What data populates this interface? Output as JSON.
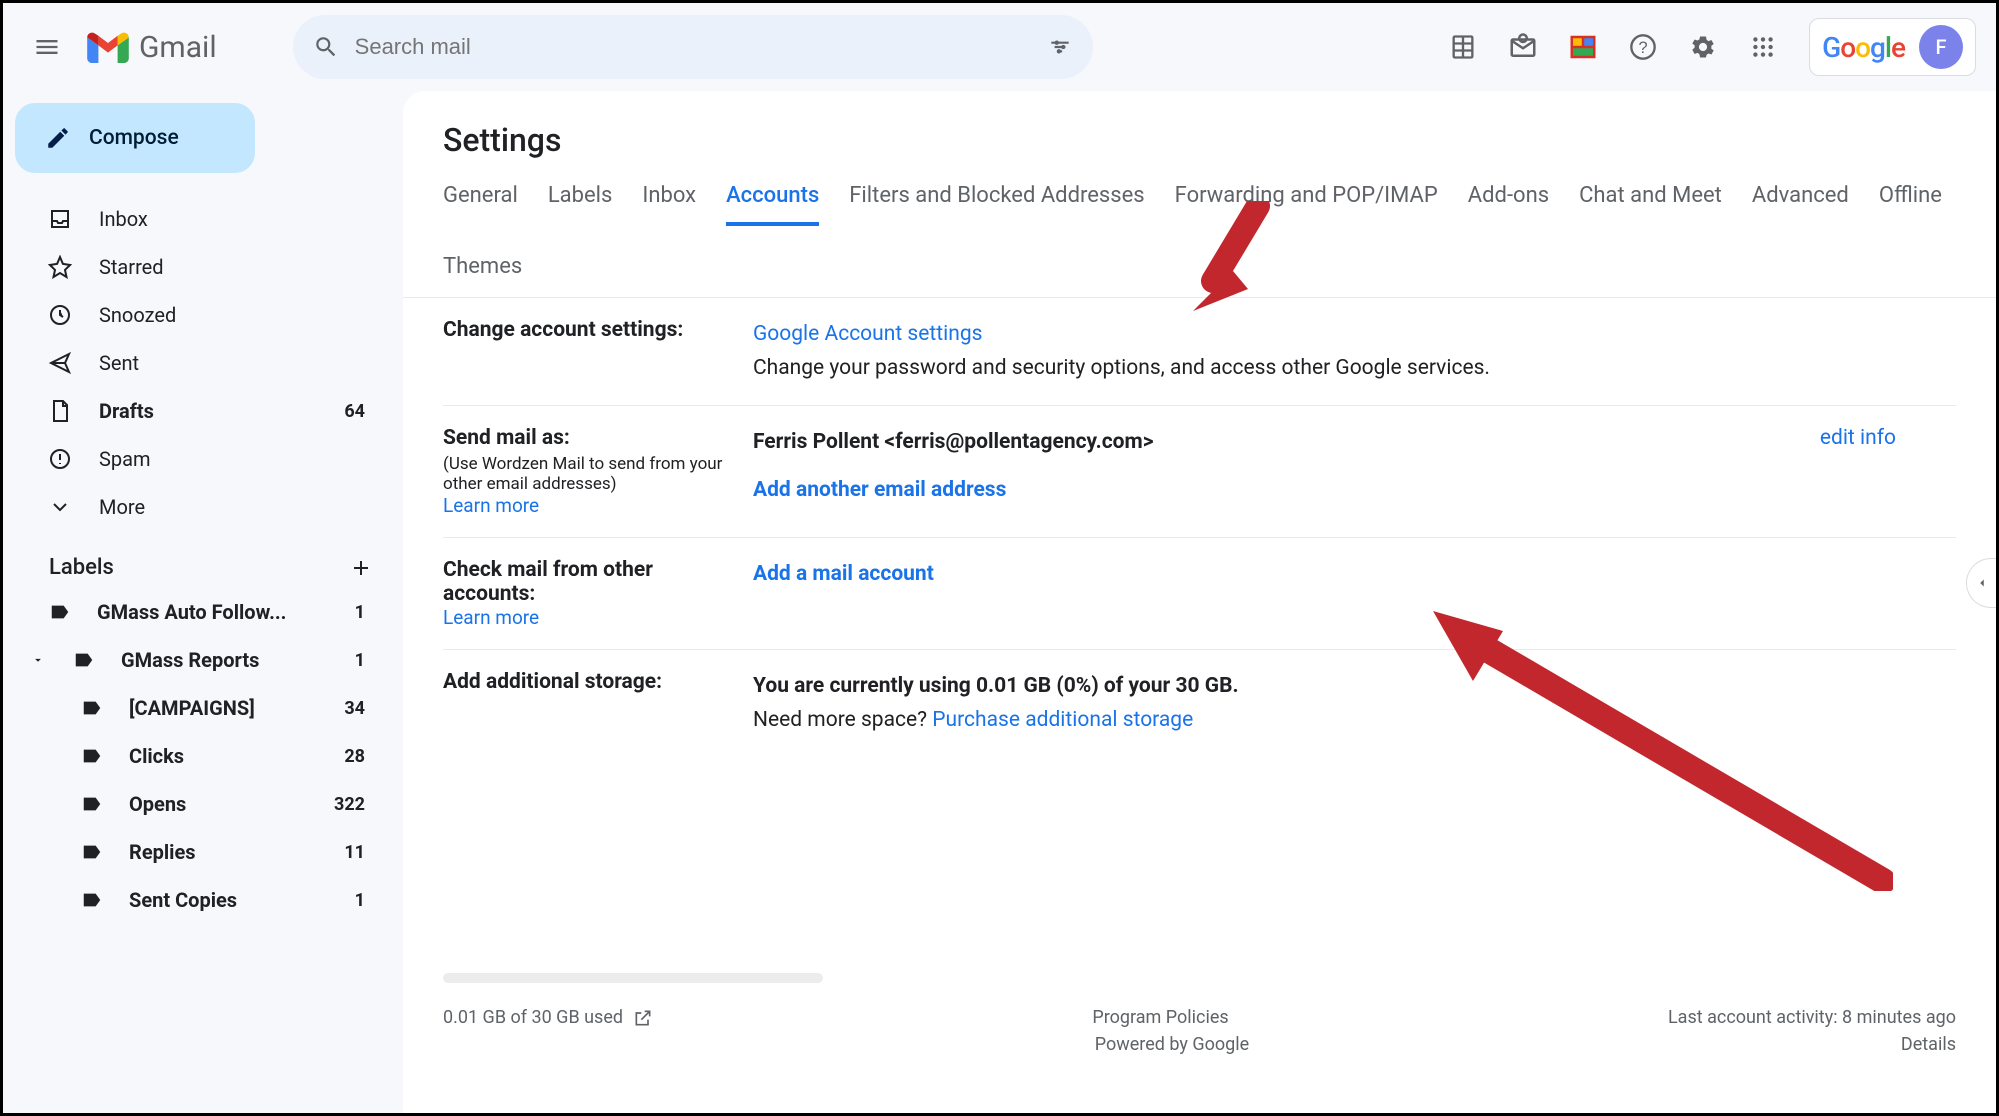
{
  "header": {
    "app_name": "Gmail",
    "search_placeholder": "Search mail",
    "avatar_letter": "F",
    "google_word": "Google"
  },
  "sidebar": {
    "compose": "Compose",
    "items": [
      {
        "label": "Inbox",
        "count": ""
      },
      {
        "label": "Starred",
        "count": ""
      },
      {
        "label": "Snoozed",
        "count": ""
      },
      {
        "label": "Sent",
        "count": ""
      },
      {
        "label": "Drafts",
        "count": "64"
      },
      {
        "label": "Spam",
        "count": ""
      },
      {
        "label": "More",
        "count": ""
      }
    ],
    "labels_header": "Labels",
    "labels": [
      {
        "label": "GMass Auto Follow...",
        "count": "1"
      },
      {
        "label": "GMass Reports",
        "count": "1"
      },
      {
        "label": "[CAMPAIGNS]",
        "count": "34"
      },
      {
        "label": "Clicks",
        "count": "28"
      },
      {
        "label": "Opens",
        "count": "322"
      },
      {
        "label": "Replies",
        "count": "11"
      },
      {
        "label": "Sent Copies",
        "count": "1"
      }
    ]
  },
  "settings": {
    "title": "Settings",
    "tabs": [
      "General",
      "Labels",
      "Inbox",
      "Accounts",
      "Filters and Blocked Addresses",
      "Forwarding and POP/IMAP",
      "Add-ons",
      "Chat and Meet",
      "Advanced",
      "Offline",
      "Themes"
    ],
    "active_tab_index": 3,
    "change_account": {
      "title": "Change account settings:",
      "link": "Google Account settings",
      "desc": "Change your password and security options, and access other Google services."
    },
    "send_mail_as": {
      "title": "Send mail as:",
      "subtitle": "(Use Wordzen Mail to send from your other email addresses)",
      "learn_more": "Learn more",
      "identity": "Ferris Pollent <ferris@pollentagency.com>",
      "add_link": "Add another email address",
      "edit": "edit info"
    },
    "check_mail": {
      "title": "Check mail from other accounts:",
      "learn_more": "Learn more",
      "add_link": "Add a mail account"
    },
    "storage": {
      "title": "Add additional storage:",
      "usage_bold": "You are currently using 0.01 GB (0%) of your 30 GB.",
      "need_more": "Need more space? ",
      "purchase": "Purchase additional storage"
    }
  },
  "footer": {
    "usage": "0.01 GB of 30 GB used",
    "policies": "Program Policies",
    "powered": "Powered by Google",
    "activity": "Last account activity: 8 minutes ago",
    "details": "Details"
  }
}
